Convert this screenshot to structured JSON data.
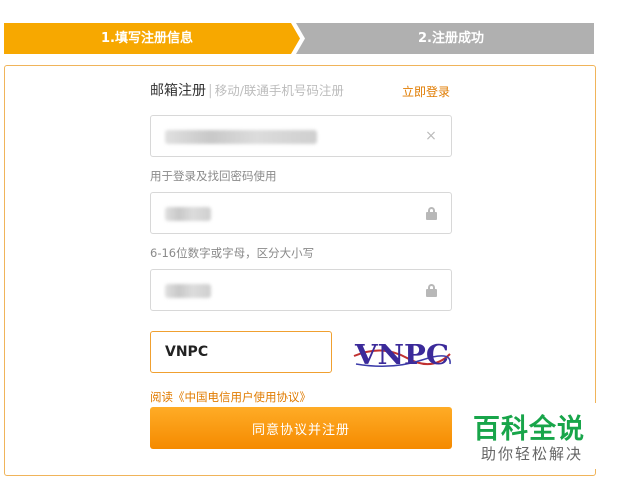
{
  "steps": {
    "step1": "1.填写注册信息",
    "step2": "2.注册成功"
  },
  "tabs": {
    "active": "邮箱注册",
    "separator": "|",
    "other": "移动/联通手机号码注册",
    "login_link": "立即登录"
  },
  "form": {
    "email_clear_icon": "×",
    "email_hint": "用于登录及找回密码使用",
    "password_hint": "6-16位数字或字母，区分大小写",
    "captcha_value": "VNPC",
    "captcha_image_text": "VNPC",
    "agreement_prefix": "阅读",
    "agreement_link": "《中国电信用户使用协议》",
    "submit_label": "同意协议并注册"
  },
  "watermark": {
    "title": "百科全说",
    "subtitle": "助你轻松解决"
  },
  "colors": {
    "accent": "#f7a800",
    "link": "#e07b00",
    "inactive_step": "#b0b0b0",
    "watermark_green": "#18a54a"
  },
  "icons": {
    "clear": "close-icon",
    "password": "lock-icon"
  }
}
